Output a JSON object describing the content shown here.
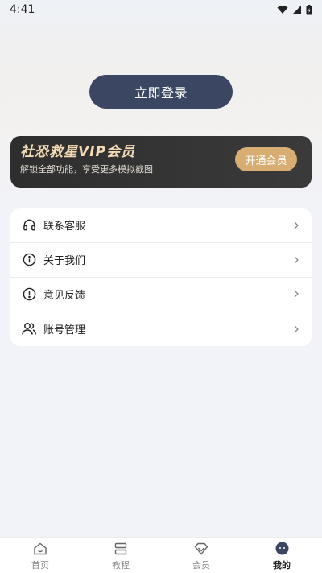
{
  "status_bar": {
    "time": "4:41"
  },
  "login_button": {
    "label": "立即登录"
  },
  "vip_card": {
    "title": "社恐救星VIP会员",
    "subtitle": "解锁全部功能，享受更多模拟截图",
    "button_label": "开通会员",
    "accent_color": "#d7ad72"
  },
  "menu": {
    "items": [
      {
        "label": "联系客服",
        "icon": "headphones-icon"
      },
      {
        "label": "关于我们",
        "icon": "info-icon"
      },
      {
        "label": "意见反馈",
        "icon": "info-icon"
      },
      {
        "label": "账号管理",
        "icon": "users-icon"
      }
    ]
  },
  "tabbar": {
    "items": [
      {
        "label": "首页",
        "icon": "home-icon",
        "active": false
      },
      {
        "label": "教程",
        "icon": "book-icon",
        "active": false
      },
      {
        "label": "会员",
        "icon": "diamond-icon",
        "active": false
      },
      {
        "label": "我的",
        "icon": "profile-icon",
        "active": true
      }
    ]
  }
}
